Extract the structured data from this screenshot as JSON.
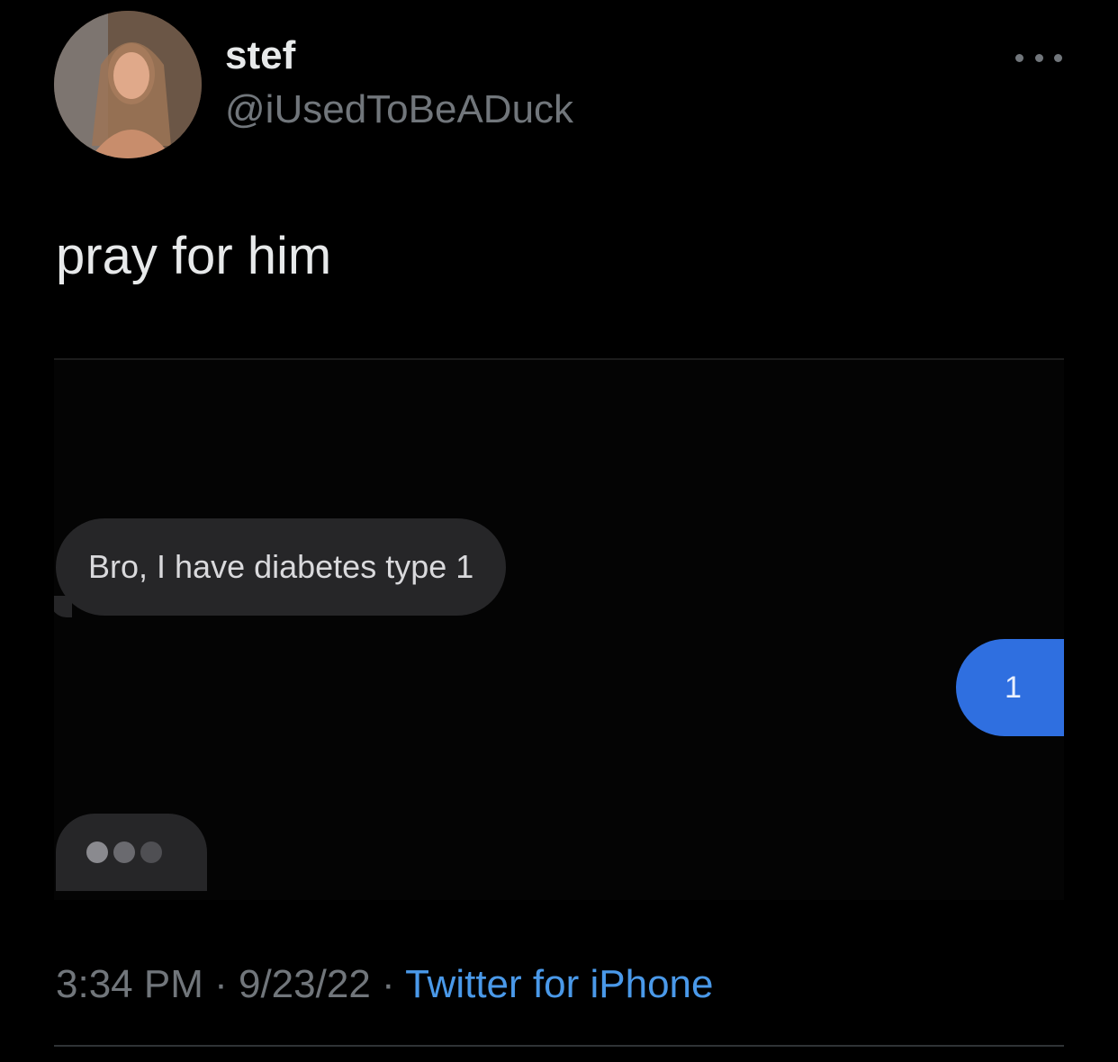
{
  "author": {
    "display_name": "stef",
    "handle": "@iUsedToBeADuck"
  },
  "tweet": {
    "text": "pray for him"
  },
  "media": {
    "messages": [
      {
        "sender": "other",
        "text": "Bro, I have diabetes type 1"
      },
      {
        "sender": "me",
        "text": "1"
      },
      {
        "sender": "other",
        "typing_indicator": true
      }
    ]
  },
  "meta": {
    "time": "3:34 PM",
    "separator": " · ",
    "date": "9/23/22",
    "source": "Twitter for iPhone"
  },
  "icons": {
    "more": "more-horizontal-icon",
    "typing": "typing-dots-icon"
  },
  "colors": {
    "background": "#000000",
    "primary_text": "#e7e9ea",
    "secondary_text": "#71767b",
    "link": "#4a99e9",
    "imessage_blue": "#2f6fe0",
    "imessage_gray": "#262628"
  }
}
